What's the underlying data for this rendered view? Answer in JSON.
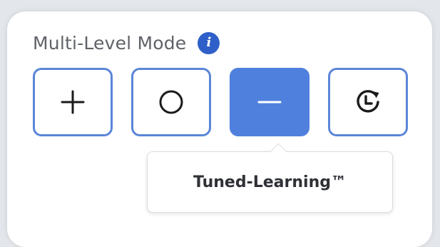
{
  "panel": {
    "title": "Multi-Level Mode",
    "info_icon": "info-icon"
  },
  "modes": [
    {
      "icon": "plus-icon",
      "active": false
    },
    {
      "icon": "circle-icon",
      "active": false
    },
    {
      "icon": "minus-icon",
      "active": true
    },
    {
      "icon": "clock-refresh-icon",
      "active": false
    }
  ],
  "tooltip": {
    "text": "Tuned-Learning™"
  },
  "colors": {
    "accent": "#4f80dd",
    "border": "#5a86d8",
    "info_badge": "#2f5fc8",
    "title_text": "#5f6368"
  }
}
